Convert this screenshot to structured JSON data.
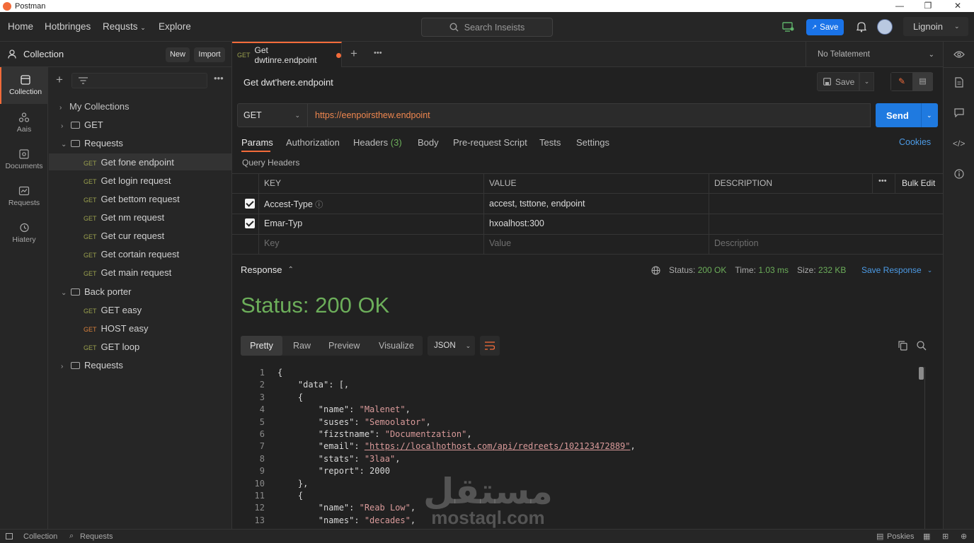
{
  "app": {
    "title": "Postman"
  },
  "nav": {
    "home": "Home",
    "hotbringes": "Hotbringes",
    "requsts": "Requsts",
    "explore": "Explore",
    "search_placeholder": "Search Inseists",
    "save": "Save",
    "user": "Lignoin"
  },
  "sidebar": {
    "header": "Collection",
    "new_btn": "New",
    "import_btn": "Import",
    "rail": [
      {
        "label": "Collection",
        "icon": "collection-icon"
      },
      {
        "label": "Aais",
        "icon": "apis-icon"
      },
      {
        "label": "Documents",
        "icon": "documents-icon"
      },
      {
        "label": "Requests",
        "icon": "requests-icon"
      },
      {
        "label": "Hiatery",
        "icon": "history-icon"
      }
    ],
    "tree": {
      "root": "My Collections",
      "get_folder": "GET",
      "requests_folder": "Requests",
      "requests": [
        {
          "method": "GET",
          "name": "Get fone endpoint"
        },
        {
          "method": "GET",
          "name": "Get login request"
        },
        {
          "method": "GET",
          "name": "Get bettom request"
        },
        {
          "method": "GET",
          "name": "Get nm request"
        },
        {
          "method": "GET",
          "name": "Get cur request"
        },
        {
          "method": "GET",
          "name": "Get cortain request"
        },
        {
          "method": "GET",
          "name": "Get main request"
        }
      ],
      "back_folder": "Back porter",
      "back_items": [
        {
          "method": "GET",
          "name": "GET easy"
        },
        {
          "method": "GET",
          "name": "HOST easy"
        },
        {
          "method": "GET",
          "name": "GET loop"
        }
      ],
      "last_folder": "Requests"
    }
  },
  "tab": {
    "method": "GET",
    "title": "Get dwtinre.endpoint",
    "env": "No Telatement"
  },
  "request": {
    "name": "Get dwt'here.endpoint",
    "save": "Save",
    "method": "GET",
    "url": "https://eenpoirsthew.endpoint",
    "send": "Send",
    "tabs": [
      "Params",
      "Authorization",
      "Headers",
      "Body",
      "Pre-request Script",
      "Tests",
      "Settings"
    ],
    "headers_count": "(3)",
    "cookies": "Cookies",
    "query_headers": "Query Headers",
    "table": {
      "cols": [
        "KEY",
        "VALUE",
        "DESCRIPTION"
      ],
      "bulk": "Bulk Edit",
      "rows": [
        {
          "key": "Accest-Type",
          "value": "accest, tsttone, endpoint",
          "desc": ""
        },
        {
          "key": "Emar-Typ",
          "value": "hxoalhost:300",
          "desc": ""
        }
      ],
      "placeholders": {
        "key": "Key",
        "value": "Value",
        "desc": "Description"
      }
    }
  },
  "response": {
    "label": "Response",
    "status_label": "Status:",
    "status": "200 OK",
    "time_label": "Time:",
    "time": "1.03 ms",
    "size_label": "Size:",
    "size": "232 KB",
    "save_response": "Save Response",
    "big_status": "Status: 200 OK",
    "view_tabs": [
      "Pretty",
      "Raw",
      "Preview",
      "Visualize"
    ],
    "format": "JSON",
    "lines": [
      {
        "n": "1",
        "t": "{"
      },
      {
        "n": "2",
        "t": "    \"data\": [,"
      },
      {
        "n": "3",
        "t": "    {"
      },
      {
        "n": "4",
        "t": "        \"name\": \"Malenet\","
      },
      {
        "n": "5",
        "t": "        \"suses\": \"Semoolator\","
      },
      {
        "n": "6",
        "t": "        \"fizstname\": \"Documentzation\","
      },
      {
        "n": "7",
        "t": "        \"email\": \"https://localhothost.com/api/redreets/102123472889\","
      },
      {
        "n": "8",
        "t": "        \"stats\": \"3laa\","
      },
      {
        "n": "9",
        "t": "        \"report\": 2000"
      },
      {
        "n": "10",
        "t": "    },"
      },
      {
        "n": "11",
        "t": "    {"
      },
      {
        "n": "12",
        "t": "        \"name\": \"Reab Low\","
      },
      {
        "n": "13",
        "t": "        \"names\": \"decades\","
      }
    ]
  },
  "statusbar": {
    "collection": "Collection",
    "requests": "Requests",
    "poskies": "Poskies"
  },
  "watermark": {
    "arabic": "مستقل",
    "latin": "mostaql.com"
  },
  "colors": {
    "accent": "#1a73e8",
    "send": "#1f7ae0",
    "status_green": "#6cae5a",
    "orange": "#f26b3a",
    "link": "#4c9be6"
  }
}
